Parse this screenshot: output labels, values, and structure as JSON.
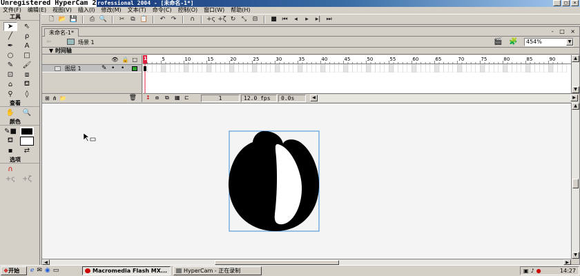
{
  "window": {
    "watermark": "Unregistered HyperCam 2",
    "title": "rofessional 2004 - [未命名-1*]",
    "min": "_",
    "max": "□",
    "close": "×"
  },
  "menu": [
    "文件(F)",
    "编辑(E)",
    "视图(V)",
    "插入(I)",
    "修改(M)",
    "文本(T)",
    "命令(C)",
    "控制(O)",
    "窗口(W)",
    "帮助(H)"
  ],
  "toolbar_icons": [
    "new-icon",
    "open-icon",
    "save-icon",
    "print-icon",
    "print-preview-icon",
    "cut-icon",
    "copy-icon",
    "paste-icon",
    "undo-icon",
    "redo-icon",
    "snap-icon",
    "smooth-icon",
    "straighten-icon",
    "rotate-icon",
    "scale-icon",
    "align-icon",
    "stop-icon",
    "rewind-icon",
    "step-back-icon",
    "play-icon",
    "step-forward-icon",
    "end-icon"
  ],
  "tools": {
    "title": "工具",
    "view_title": "查看",
    "colors_title": "颜色",
    "options_title": "选项"
  },
  "document": {
    "tab_name": "未命名-1*",
    "scene": "场景 1",
    "zoom": "454%",
    "controls": "- □ ×"
  },
  "timeline": {
    "title": "时间轴",
    "layer_name": "图层 1",
    "ruler_labels": [
      "1",
      "5",
      "10",
      "15",
      "20",
      "25",
      "30",
      "35",
      "40",
      "45",
      "50",
      "55",
      "60",
      "65",
      "70",
      "75",
      "80",
      "85",
      "90"
    ],
    "current_frame": "1",
    "fps": "12.0 fps",
    "time": "0.0s"
  },
  "taskbar": {
    "start": "开始",
    "task1": "Macromedia Flash MX...",
    "task2": "HyperCam - 正在录制",
    "clock": "14:27"
  }
}
